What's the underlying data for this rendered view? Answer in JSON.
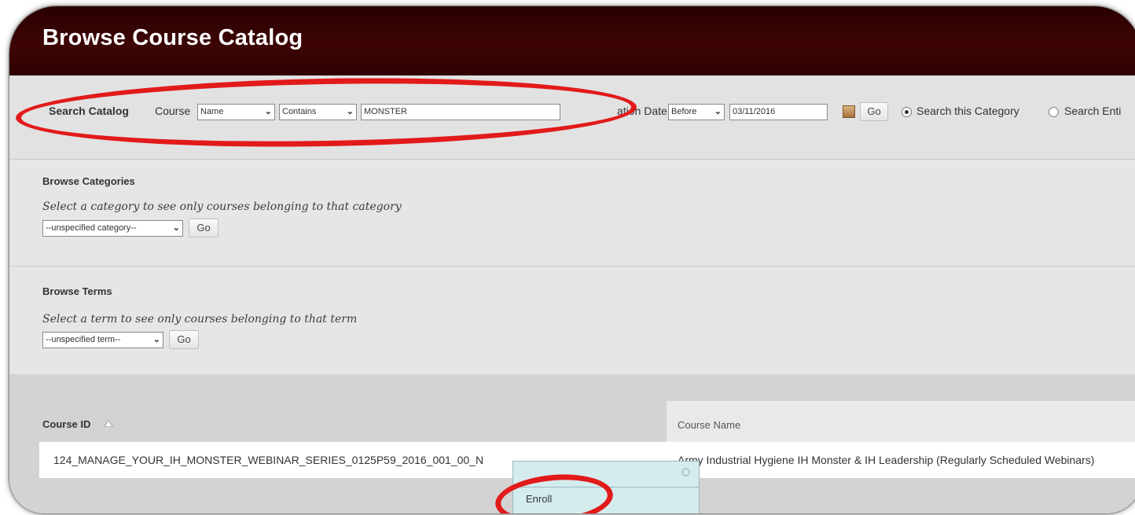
{
  "page": {
    "title": "Browse Course Catalog"
  },
  "search": {
    "label": "Search Catalog",
    "course_label": "Course",
    "field_select": "Name",
    "operator_select": "Contains",
    "query_value": "MONSTER",
    "date_label": "ation Date",
    "date_operator": "Before",
    "date_value": "03/11/2016",
    "go_label": "Go",
    "scope_this_label": "Search this Category",
    "scope_entire_label": "Search Enti"
  },
  "browse_categories": {
    "title": "Browse Categories",
    "instruction": "Select a category to see only courses belonging to that category",
    "select_value": "--unspecified category--",
    "go_label": "Go"
  },
  "browse_terms": {
    "title": "Browse Terms",
    "instruction": "Select a term to see only courses belonging to that term",
    "select_value": "--unspecified term--",
    "go_label": "Go"
  },
  "table": {
    "headers": [
      "Course ID",
      "Course Name"
    ],
    "rows": [
      {
        "course_id": "124_MANAGE_YOUR_IH_MONSTER_WEBINAR_SERIES_0125P59_2016_001_00_N",
        "course_name": "Army Industrial Hygiene IH Monster & IH Leadership (Regularly Scheduled Webinars)"
      }
    ]
  },
  "context_menu": {
    "items": [
      "Enroll"
    ]
  },
  "icons": {
    "sort": "sort-ascending-icon",
    "calendar": "calendar-icon",
    "close": "close-icon",
    "dropdown": "chevron-down-icon"
  },
  "colors": {
    "header_bg": "#3d0505",
    "annotation": "#e21a1a",
    "menu_bg": "#d5ecef"
  }
}
